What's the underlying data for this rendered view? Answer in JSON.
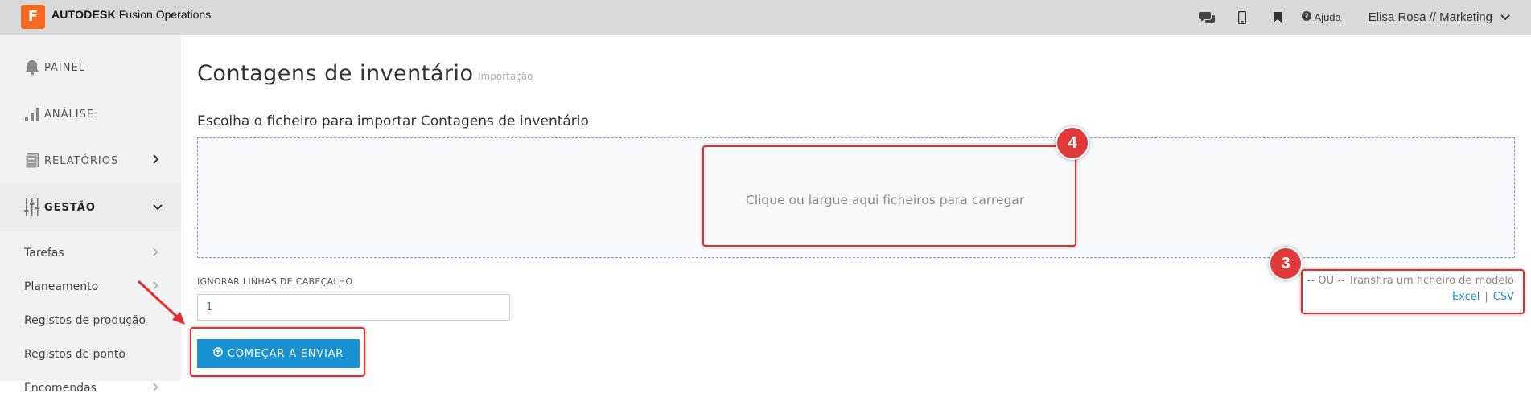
{
  "header": {
    "logo_letter": "F",
    "brand_bold": "AUTODESK",
    "brand_product": "Fusion Operations",
    "help_label": "Ajuda",
    "user_label": "Elisa Rosa // Marketing",
    "icons": [
      "chat-icon",
      "mobile-icon",
      "bookmark-icon",
      "help-icon",
      "chevron-down-icon"
    ]
  },
  "sidebar": {
    "items": [
      {
        "label": "PAINEL",
        "icon": "bell-icon"
      },
      {
        "label": "ANÁLISE",
        "icon": "bar-chart-icon"
      },
      {
        "label": "RELATÓRIOS",
        "icon": "document-icon",
        "chevron": "›"
      },
      {
        "label": "GESTÃO",
        "icon": "sliders-icon",
        "chevron": "⌄"
      }
    ],
    "subitems": [
      {
        "label": "Tarefas",
        "chevron": "›"
      },
      {
        "label": "Planeamento",
        "chevron": "›"
      },
      {
        "label": "Registos de produção"
      },
      {
        "label": "Registos de ponto"
      },
      {
        "label": "Encomendas",
        "chevron": "›"
      }
    ]
  },
  "main": {
    "title": "Contagens de inventário",
    "subtitle": "Importação",
    "choose_label": "Escolha o ficheiro para importar Contagens de inventário",
    "drop_text": "Clique ou largue aqui ficheiros para carregar",
    "or_text": "-- OU -- Transfira um ficheiro de modelo",
    "template_links": {
      "excel": "Excel",
      "separator": "|",
      "csv": "CSV"
    },
    "ignore_label": "IGNORAR LINHAS DE CABEÇALHO",
    "ignore_value": "1",
    "start_button": "COMEÇAR A ENVIAR"
  },
  "annotations": {
    "badge_3": "3",
    "badge_4": "4"
  },
  "colors": {
    "accent": "#1992d4",
    "annotation_red": "#e52b2b",
    "logo_orange": "#f26b21"
  }
}
